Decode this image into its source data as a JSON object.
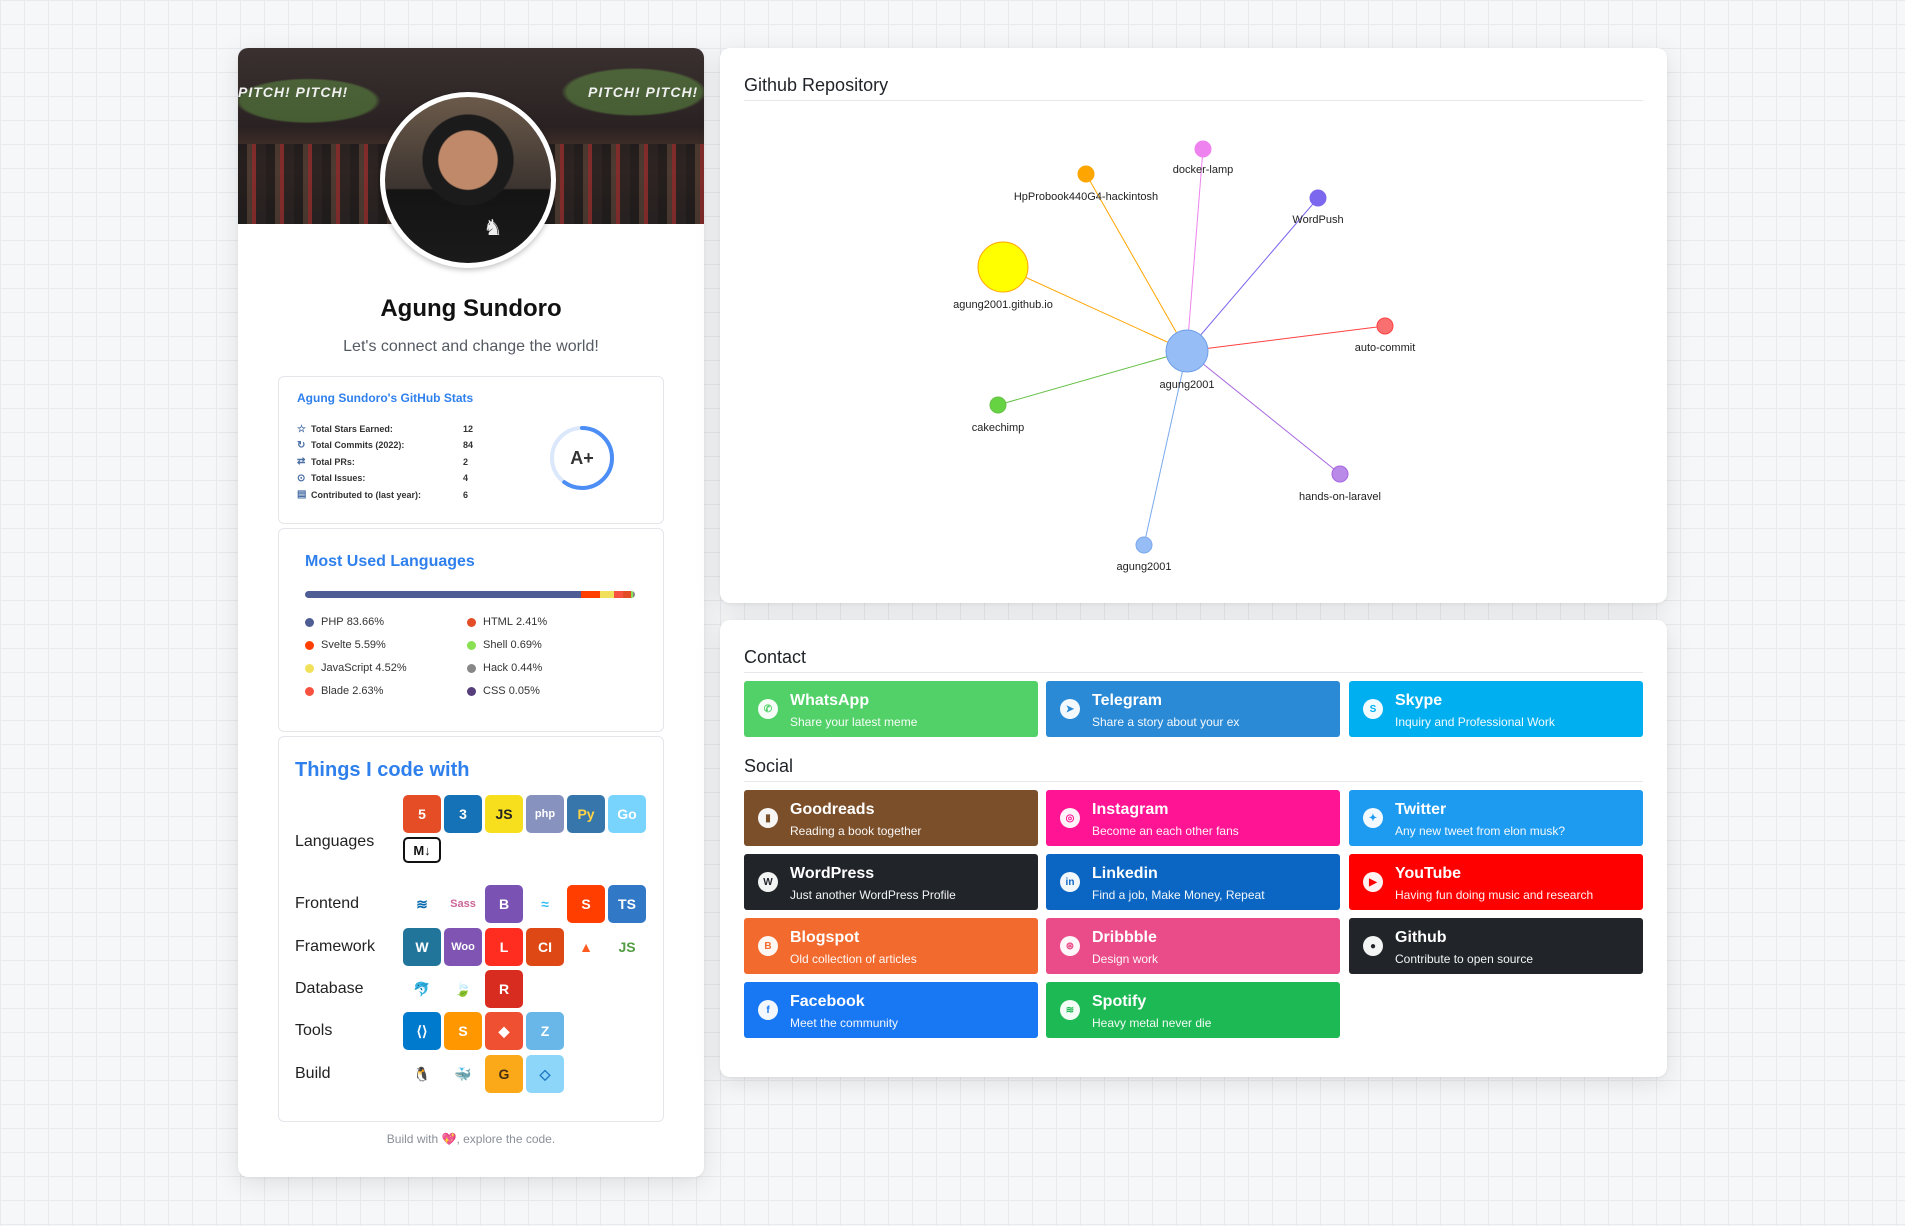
{
  "profile": {
    "name": "Agung Sundoro",
    "tagline": "Let's connect and change the world!",
    "cover_banner": "PITCH! PITCH!",
    "stats": {
      "title": "Agung Sundoro's GitHub Stats",
      "rows": [
        {
          "icon": "star-icon",
          "label": "Total Stars Earned:",
          "value": "12"
        },
        {
          "icon": "history-icon",
          "label": "Total Commits (2022):",
          "value": "84"
        },
        {
          "icon": "pull-request-icon",
          "label": "Total PRs:",
          "value": "2"
        },
        {
          "icon": "issue-icon",
          "label": "Total Issues:",
          "value": "4"
        },
        {
          "icon": "repo-icon",
          "label": "Contributed to (last year):",
          "value": "6"
        }
      ],
      "grade": "A+",
      "grade_ring_fraction": 0.6,
      "ring_color": "#4c8ef5"
    },
    "languages": {
      "title": "Most Used Languages",
      "items": [
        {
          "name": "PHP",
          "percent": "83.66%",
          "value": 83.66,
          "color": "#4F5D95"
        },
        {
          "name": "Svelte",
          "percent": "5.59%",
          "value": 5.59,
          "color": "#ff3e00"
        },
        {
          "name": "JavaScript",
          "percent": "4.52%",
          "value": 4.52,
          "color": "#f1e05a"
        },
        {
          "name": "Blade",
          "percent": "2.63%",
          "value": 2.63,
          "color": "#f7523f"
        },
        {
          "name": "HTML",
          "percent": "2.41%",
          "value": 2.41,
          "color": "#e34c26"
        },
        {
          "name": "Shell",
          "percent": "0.69%",
          "value": 0.69,
          "color": "#89e051"
        },
        {
          "name": "Hack",
          "percent": "0.44%",
          "value": 0.44,
          "color": "#878787"
        },
        {
          "name": "CSS",
          "percent": "0.05%",
          "value": 0.05,
          "color": "#563d7c"
        }
      ]
    },
    "things": {
      "title": "Things I code with",
      "categories": [
        {
          "label": "Languages",
          "icons": [
            {
              "name": "html5-icon",
              "text": "5",
              "bg": "#e44d26",
              "fg": "#fff"
            },
            {
              "name": "css3-icon",
              "text": "3",
              "bg": "#1572b6",
              "fg": "#fff"
            },
            {
              "name": "javascript-icon",
              "text": "JS",
              "bg": "#f7df1e",
              "fg": "#222"
            },
            {
              "name": "php-icon",
              "text": "php",
              "bg": "#8892bf",
              "fg": "#fff"
            },
            {
              "name": "python-icon",
              "text": "Py",
              "bg": "#3776ab",
              "fg": "#ffd343"
            },
            {
              "name": "go-icon",
              "text": "Go",
              "bg": "#79d4fd",
              "fg": "#fff"
            },
            {
              "name": "markdown-icon",
              "text": "M↓",
              "bg": "#ffffff",
              "fg": "#111"
            }
          ]
        },
        {
          "label": "Frontend",
          "icons": [
            {
              "name": "jquery-icon",
              "text": "≋",
              "bg": "#ffffff",
              "fg": "#0769ad"
            },
            {
              "name": "sass-icon",
              "text": "Sass",
              "bg": "#ffffff",
              "fg": "#cc6699"
            },
            {
              "name": "bootstrap-icon",
              "text": "B",
              "bg": "#7952b3",
              "fg": "#fff"
            },
            {
              "name": "tailwind-icon",
              "text": "≈",
              "bg": "#ffffff",
              "fg": "#38bdf8"
            },
            {
              "name": "svelte-icon",
              "text": "S",
              "bg": "#ff3e00",
              "fg": "#fff"
            },
            {
              "name": "typescript-icon",
              "text": "TS",
              "bg": "#3178c6",
              "fg": "#fff"
            }
          ]
        },
        {
          "label": "Framework",
          "icons": [
            {
              "name": "wordpress-icon",
              "text": "W",
              "bg": "#21759b",
              "fg": "#fff"
            },
            {
              "name": "woocommerce-icon",
              "text": "Woo",
              "bg": "#7f54b3",
              "fg": "#fff"
            },
            {
              "name": "laravel-icon",
              "text": "L",
              "bg": "#ff2d20",
              "fg": "#fff"
            },
            {
              "name": "codeigniter-icon",
              "text": "CI",
              "bg": "#dd4814",
              "fg": "#fff"
            },
            {
              "name": "hack-icon",
              "text": "▲",
              "bg": "#ffffff",
              "fg": "#ff5a1f"
            },
            {
              "name": "nodejs-icon",
              "text": "JS",
              "bg": "#ffffff",
              "fg": "#539e43"
            }
          ]
        },
        {
          "label": "Database",
          "icons": [
            {
              "name": "mysql-icon",
              "text": "🐬",
              "bg": "#ffffff",
              "fg": "#00758f"
            },
            {
              "name": "mongodb-icon",
              "text": "🍃",
              "bg": "#ffffff",
              "fg": "#47a248"
            },
            {
              "name": "redis-icon",
              "text": "R",
              "bg": "#d82c20",
              "fg": "#fff"
            }
          ]
        },
        {
          "label": "Tools",
          "icons": [
            {
              "name": "vscode-icon",
              "text": "⟨⟩",
              "bg": "#007acc",
              "fg": "#fff"
            },
            {
              "name": "sublime-icon",
              "text": "S",
              "bg": "#ff9800",
              "fg": "#fff"
            },
            {
              "name": "git-icon",
              "text": "◆",
              "bg": "#f05032",
              "fg": "#fff"
            },
            {
              "name": "zend-icon",
              "text": "Z",
              "bg": "#68b7e8",
              "fg": "#fff"
            }
          ]
        },
        {
          "label": "Build",
          "icons": [
            {
              "name": "linux-icon",
              "text": "🐧",
              "bg": "#ffffff",
              "fg": "#000"
            },
            {
              "name": "docker-icon",
              "text": "🐳",
              "bg": "#ffffff",
              "fg": "#2496ed"
            },
            {
              "name": "grunt-icon",
              "text": "G",
              "bg": "#fba919",
              "fg": "#463014"
            },
            {
              "name": "webpack-icon",
              "text": "◇",
              "bg": "#8dd6f9",
              "fg": "#1c78c0"
            }
          ]
        }
      ]
    },
    "footer": {
      "prefix": "Build with",
      "heart": "💖",
      "suffix": ", explore the code."
    }
  },
  "repository": {
    "title": "Github Repository",
    "center": {
      "label": "agung2001",
      "color": "#97bdf6"
    },
    "nodes": [
      {
        "label": "docker-lamp",
        "color": "#ee82ee",
        "edge": "#ee82ee"
      },
      {
        "label": "HpProbook440G4-hackintosh",
        "color": "#ffa500",
        "edge": "#ffa500"
      },
      {
        "label": "WordPush",
        "color": "#7b68ee",
        "edge": "#7b68ee"
      },
      {
        "label": "agung2001.github.io",
        "color": "#ffff00",
        "edge": "#ffa500"
      },
      {
        "label": "auto-commit",
        "color": "#fa7070",
        "edge": "#ff4040"
      },
      {
        "label": "cakechimp",
        "color": "#66d442",
        "edge": "#66c046"
      },
      {
        "label": "hands-on-laravel",
        "color": "#b98ae8",
        "edge": "#a766e0"
      },
      {
        "label": "agung2001",
        "color": "#97bdf6",
        "edge": "#7aa9ec"
      }
    ]
  },
  "contact": {
    "title": "Contact",
    "items": [
      {
        "name": "whatsapp",
        "icon": "whatsapp-icon",
        "glyph": "✆",
        "title": "WhatsApp",
        "subtitle": "Share your latest meme",
        "color": "#52d168"
      },
      {
        "name": "telegram",
        "icon": "telegram-icon",
        "glyph": "➤",
        "title": "Telegram",
        "subtitle": "Share a story about your ex",
        "color": "#2a8ad6"
      },
      {
        "name": "skype",
        "icon": "skype-icon",
        "glyph": "S",
        "title": "Skype",
        "subtitle": "Inquiry and Professional Work",
        "color": "#00aff0"
      }
    ]
  },
  "social": {
    "title": "Social",
    "items": [
      {
        "name": "goodreads",
        "icon": "book-icon",
        "glyph": "▮",
        "title": "Goodreads",
        "subtitle": "Reading a book together",
        "color": "#7b4f2a"
      },
      {
        "name": "instagram",
        "icon": "instagram-icon",
        "glyph": "◎",
        "title": "Instagram",
        "subtitle": "Become an each other fans",
        "color": "#ff1493"
      },
      {
        "name": "twitter",
        "icon": "twitter-icon",
        "glyph": "✦",
        "title": "Twitter",
        "subtitle": "Any new tweet from elon musk?",
        "color": "#1d9bf0"
      },
      {
        "name": "wordpress",
        "icon": "wordpress-icon",
        "glyph": "W",
        "title": "WordPress",
        "subtitle": "Just another WordPress Profile",
        "color": "#212529"
      },
      {
        "name": "linkedin",
        "icon": "linkedin-icon",
        "glyph": "in",
        "title": "Linkedin",
        "subtitle": "Find a job, Make Money, Repeat",
        "color": "#0a66c2"
      },
      {
        "name": "youtube",
        "icon": "youtube-icon",
        "glyph": "▶",
        "title": "YouTube",
        "subtitle": "Having fun doing music and research",
        "color": "#ff0000"
      },
      {
        "name": "blogspot",
        "icon": "blogger-icon",
        "glyph": "B",
        "title": "Blogspot",
        "subtitle": "Old collection of articles",
        "color": "#f26a2e"
      },
      {
        "name": "dribbble",
        "icon": "dribbble-icon",
        "glyph": "⊛",
        "title": "Dribbble",
        "subtitle": "Design work",
        "color": "#ea4c89"
      },
      {
        "name": "github",
        "icon": "github-icon",
        "glyph": "●",
        "title": "Github",
        "subtitle": "Contribute to open source",
        "color": "#212529"
      },
      {
        "name": "facebook",
        "icon": "facebook-icon",
        "glyph": "f",
        "title": "Facebook",
        "subtitle": "Meet the community",
        "color": "#1877f2"
      },
      {
        "name": "spotify",
        "icon": "spotify-icon",
        "glyph": "≋",
        "title": "Spotify",
        "subtitle": "Heavy metal never die",
        "color": "#1db954"
      }
    ]
  }
}
